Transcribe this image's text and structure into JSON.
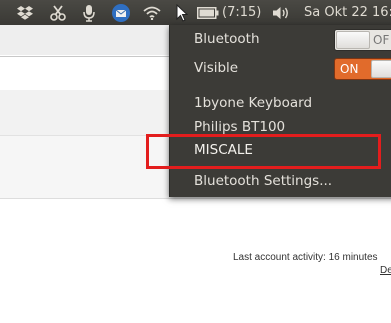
{
  "panel": {
    "battery_time": "(7:15)",
    "datetime": "Sa Okt 22 16:"
  },
  "menu": {
    "bluetooth_label": "Bluetooth",
    "bluetooth_toggle": "OF",
    "visible_label": "Visible",
    "visible_toggle": "ON",
    "devices": [
      "1byone Keyboard",
      "Philips BT100",
      "MISCALE"
    ],
    "settings_label": "Bluetooth Settings..."
  },
  "page": {
    "activity": "Last account activity: 16 minutes",
    "details": "De"
  },
  "colors": {
    "panel_bg": "#3c3b37",
    "menu_bg": "#3c3b37",
    "toggle_on": "#e16b2b",
    "highlight": "#e31d1d"
  }
}
